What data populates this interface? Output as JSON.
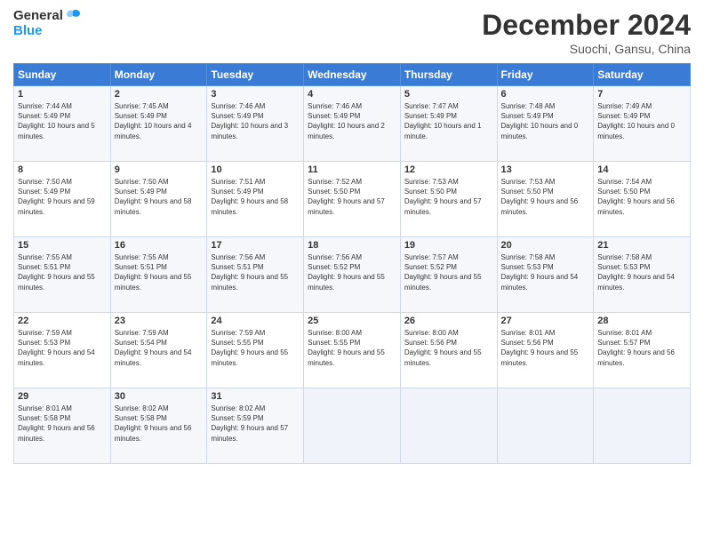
{
  "header": {
    "logo_line1": "General",
    "logo_line2": "Blue",
    "month_title": "December 2024",
    "location": "Suochi, Gansu, China"
  },
  "weekdays": [
    "Sunday",
    "Monday",
    "Tuesday",
    "Wednesday",
    "Thursday",
    "Friday",
    "Saturday"
  ],
  "weeks": [
    [
      {
        "day": "1",
        "sunrise": "7:44 AM",
        "sunset": "5:49 PM",
        "daylight": "10 hours and 5 minutes."
      },
      {
        "day": "2",
        "sunrise": "7:45 AM",
        "sunset": "5:49 PM",
        "daylight": "10 hours and 4 minutes."
      },
      {
        "day": "3",
        "sunrise": "7:46 AM",
        "sunset": "5:49 PM",
        "daylight": "10 hours and 3 minutes."
      },
      {
        "day": "4",
        "sunrise": "7:46 AM",
        "sunset": "5:49 PM",
        "daylight": "10 hours and 2 minutes."
      },
      {
        "day": "5",
        "sunrise": "7:47 AM",
        "sunset": "5:49 PM",
        "daylight": "10 hours and 1 minute."
      },
      {
        "day": "6",
        "sunrise": "7:48 AM",
        "sunset": "5:49 PM",
        "daylight": "10 hours and 0 minutes."
      },
      {
        "day": "7",
        "sunrise": "7:49 AM",
        "sunset": "5:49 PM",
        "daylight": "10 hours and 0 minutes."
      }
    ],
    [
      {
        "day": "8",
        "sunrise": "7:50 AM",
        "sunset": "5:49 PM",
        "daylight": "9 hours and 59 minutes."
      },
      {
        "day": "9",
        "sunrise": "7:50 AM",
        "sunset": "5:49 PM",
        "daylight": "9 hours and 58 minutes."
      },
      {
        "day": "10",
        "sunrise": "7:51 AM",
        "sunset": "5:49 PM",
        "daylight": "9 hours and 58 minutes."
      },
      {
        "day": "11",
        "sunrise": "7:52 AM",
        "sunset": "5:50 PM",
        "daylight": "9 hours and 57 minutes."
      },
      {
        "day": "12",
        "sunrise": "7:53 AM",
        "sunset": "5:50 PM",
        "daylight": "9 hours and 57 minutes."
      },
      {
        "day": "13",
        "sunrise": "7:53 AM",
        "sunset": "5:50 PM",
        "daylight": "9 hours and 56 minutes."
      },
      {
        "day": "14",
        "sunrise": "7:54 AM",
        "sunset": "5:50 PM",
        "daylight": "9 hours and 56 minutes."
      }
    ],
    [
      {
        "day": "15",
        "sunrise": "7:55 AM",
        "sunset": "5:51 PM",
        "daylight": "9 hours and 55 minutes."
      },
      {
        "day": "16",
        "sunrise": "7:55 AM",
        "sunset": "5:51 PM",
        "daylight": "9 hours and 55 minutes."
      },
      {
        "day": "17",
        "sunrise": "7:56 AM",
        "sunset": "5:51 PM",
        "daylight": "9 hours and 55 minutes."
      },
      {
        "day": "18",
        "sunrise": "7:56 AM",
        "sunset": "5:52 PM",
        "daylight": "9 hours and 55 minutes."
      },
      {
        "day": "19",
        "sunrise": "7:57 AM",
        "sunset": "5:52 PM",
        "daylight": "9 hours and 55 minutes."
      },
      {
        "day": "20",
        "sunrise": "7:58 AM",
        "sunset": "5:53 PM",
        "daylight": "9 hours and 54 minutes."
      },
      {
        "day": "21",
        "sunrise": "7:58 AM",
        "sunset": "5:53 PM",
        "daylight": "9 hours and 54 minutes."
      }
    ],
    [
      {
        "day": "22",
        "sunrise": "7:59 AM",
        "sunset": "5:53 PM",
        "daylight": "9 hours and 54 minutes."
      },
      {
        "day": "23",
        "sunrise": "7:59 AM",
        "sunset": "5:54 PM",
        "daylight": "9 hours and 54 minutes."
      },
      {
        "day": "24",
        "sunrise": "7:59 AM",
        "sunset": "5:55 PM",
        "daylight": "9 hours and 55 minutes."
      },
      {
        "day": "25",
        "sunrise": "8:00 AM",
        "sunset": "5:55 PM",
        "daylight": "9 hours and 55 minutes."
      },
      {
        "day": "26",
        "sunrise": "8:00 AM",
        "sunset": "5:56 PM",
        "daylight": "9 hours and 55 minutes."
      },
      {
        "day": "27",
        "sunrise": "8:01 AM",
        "sunset": "5:56 PM",
        "daylight": "9 hours and 55 minutes."
      },
      {
        "day": "28",
        "sunrise": "8:01 AM",
        "sunset": "5:57 PM",
        "daylight": "9 hours and 56 minutes."
      }
    ],
    [
      {
        "day": "29",
        "sunrise": "8:01 AM",
        "sunset": "5:58 PM",
        "daylight": "9 hours and 56 minutes."
      },
      {
        "day": "30",
        "sunrise": "8:02 AM",
        "sunset": "5:58 PM",
        "daylight": "9 hours and 56 minutes."
      },
      {
        "day": "31",
        "sunrise": "8:02 AM",
        "sunset": "5:59 PM",
        "daylight": "9 hours and 57 minutes."
      },
      null,
      null,
      null,
      null
    ]
  ],
  "labels": {
    "sunrise": "Sunrise:",
    "sunset": "Sunset:",
    "daylight": "Daylight:"
  }
}
